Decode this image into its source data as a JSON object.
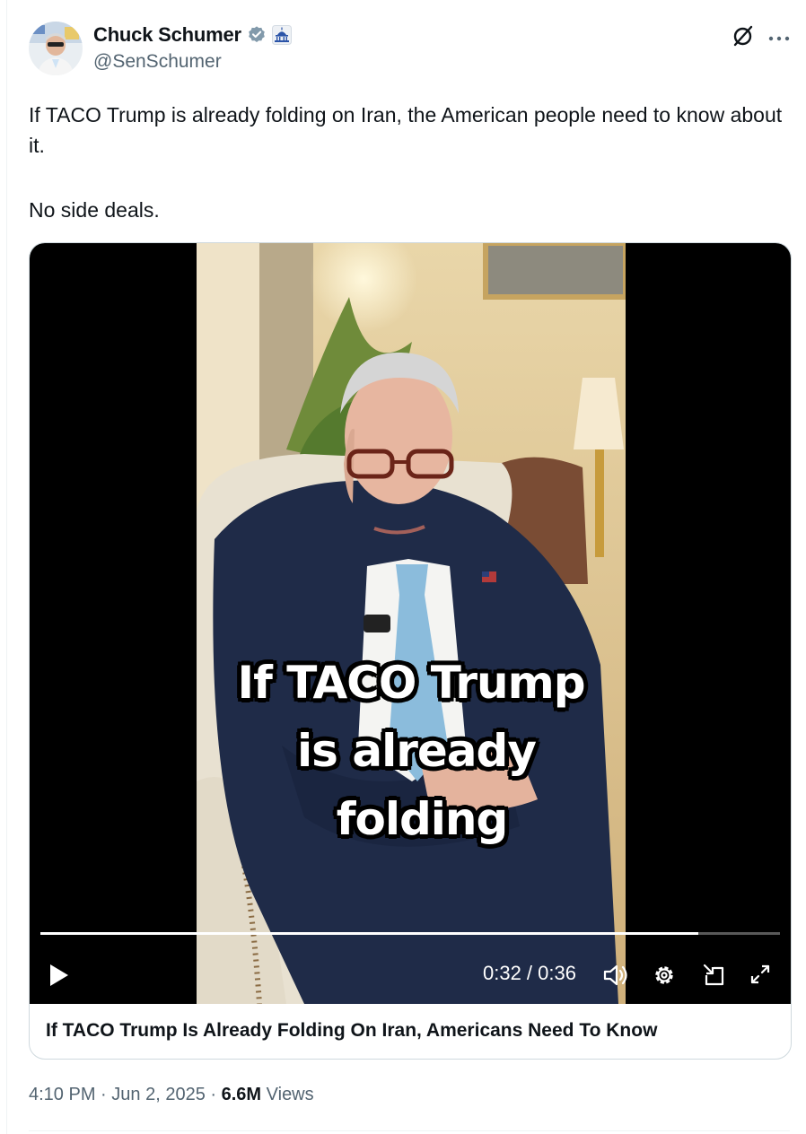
{
  "author": {
    "display_name": "Chuck Schumer",
    "handle": "@SenSchumer",
    "verified_badge": "verified-badge-icon",
    "affiliation_badge": "us-capitol-icon"
  },
  "tweet": {
    "text_lines": [
      "If TACO Trump is already folding on Iran, the American people need to know about it.",
      "No side deals."
    ]
  },
  "media": {
    "caption_lines": [
      "If TACO Trump",
      "is already",
      "folding"
    ],
    "time_display": "0:32 / 0:36",
    "progress": 0.889,
    "link_title": "If TACO Trump Is Already Folding On Iran, Americans Need To Know"
  },
  "meta": {
    "time": "4:10 PM",
    "date": "Jun 2, 2025",
    "views_count": "6.6M",
    "views_label": "Views",
    "separator": "·"
  },
  "colors": {
    "text": "#0f1419",
    "secondary": "#536471",
    "verified": "#829aab",
    "border": "#cfd9de"
  }
}
